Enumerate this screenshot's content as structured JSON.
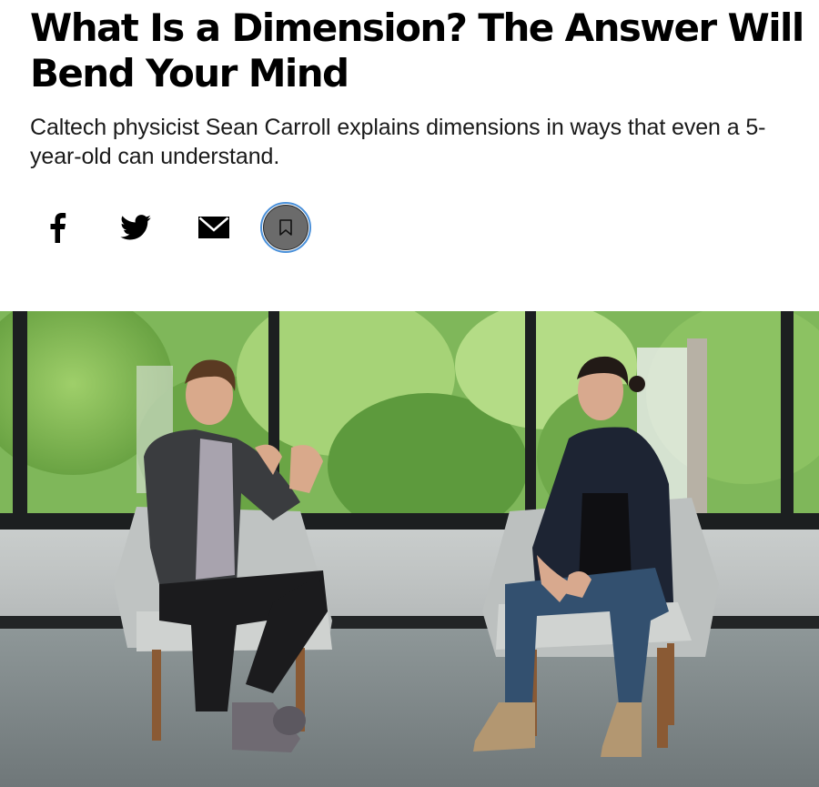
{
  "article": {
    "title": "What Is a Dimension? The Answer Will Bend Your Mind",
    "dek": "Caltech physicist Sean Carroll explains dimensions in ways that even a 5-year-old can understand."
  },
  "share": {
    "icons": [
      "facebook-icon",
      "twitter-icon",
      "email-icon",
      "bookmark-icon"
    ]
  },
  "colors": {
    "bookmark_fill": "#6b6b6b",
    "bookmark_ring": "#4a90d9"
  }
}
